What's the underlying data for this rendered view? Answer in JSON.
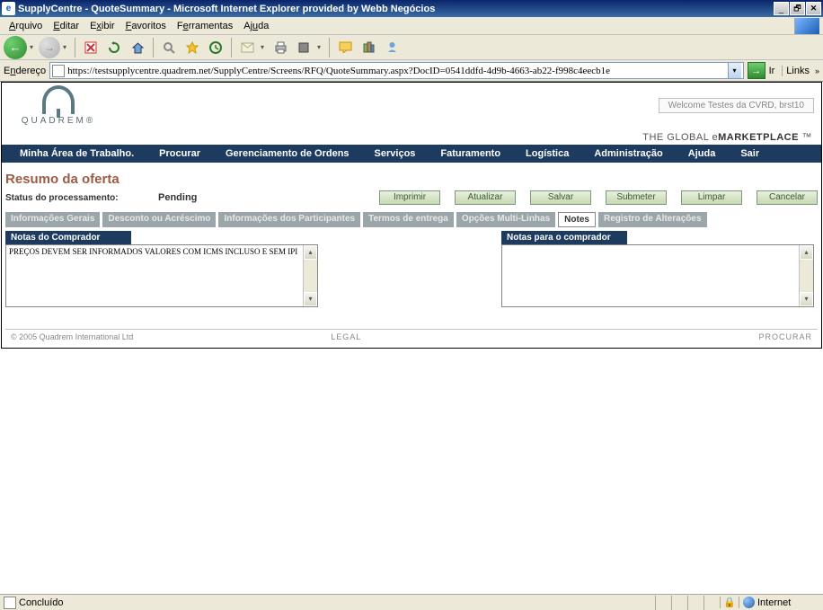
{
  "window": {
    "title": "SupplyCentre - QuoteSummary - Microsoft Internet Explorer provided by Webb Negócios"
  },
  "menubar": {
    "arquivo": "Arquivo",
    "editar": "Editar",
    "exibir": "Exibir",
    "favoritos": "Favoritos",
    "ferramentas": "Ferramentas",
    "ajuda": "Ajuda"
  },
  "addressbar": {
    "label": "Endereço",
    "url": "https://testsupplycentre.quadrem.net/SupplyCentre/Screens/RFQ/QuoteSummary.aspx?DocID=0541ddfd-4d9b-4663-ab22-f998c4eecb1e",
    "go": "Ir",
    "links": "Links"
  },
  "header": {
    "logo_text": "QUADREM®",
    "welcome": "Welcome Testes da CVRD, brst10",
    "tagline_prefix": "THE GLOBAL e",
    "tagline_bold": "MARKETPLACE",
    "tagline_suffix": " ™"
  },
  "main_nav": {
    "items": [
      "Minha Área de Trabalho.",
      "Procurar",
      "Gerenciamento de Ordens",
      "Serviços",
      "Faturamento",
      "Logística",
      "Administração",
      "Ajuda",
      "Sair"
    ]
  },
  "page": {
    "title": "Resumo da oferta",
    "status_label": "Status do processamento:",
    "status_value": "Pending"
  },
  "actions": {
    "imprimir": "Imprimir",
    "atualizar": "Atualizar",
    "salvar": "Salvar",
    "submeter": "Submeter",
    "limpar": "Limpar",
    "cancelar": "Cancelar"
  },
  "tabs": {
    "items": [
      "Informações Gerais",
      "Desconto ou Acréscimo",
      "Informações dos Participantes",
      "Termos de entrega",
      "Opções Multi-Linhas",
      "Notes",
      "Registro de Alterações"
    ],
    "active_index": 5
  },
  "notes": {
    "buyer_header": "Notas do Comprador",
    "buyer_text": "PREÇOS DEVEM SER INFORMADOS VALORES COM ICMS INCLUSO E SEM IPI",
    "to_buyer_header": "Notas para o comprador",
    "to_buyer_text": ""
  },
  "footer": {
    "copyright": "© 2005 Quadrem International Ltd",
    "legal": "LEGAL",
    "procurar": "PROCURAR"
  },
  "statusbar": {
    "text": "Concluído",
    "zone": "Internet"
  }
}
